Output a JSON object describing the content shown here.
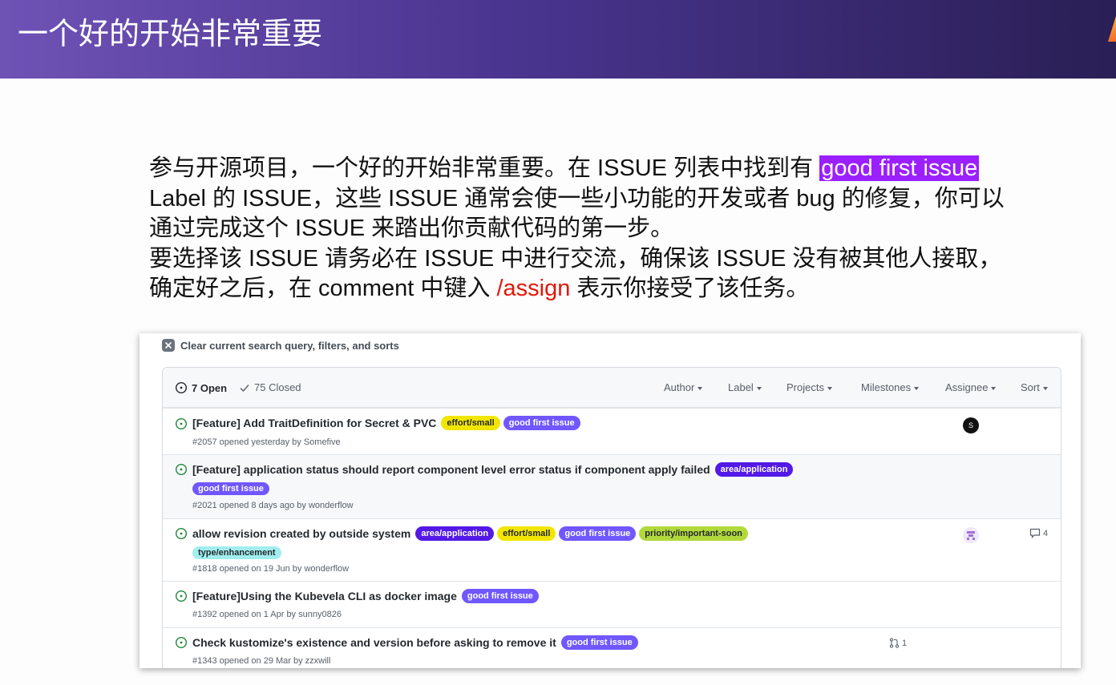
{
  "slide": {
    "title": "一个好的开始非常重要",
    "intro": {
      "l1_a": "参与开源项目，一个好的开始非常重要。在 ISSUE 列表中找到有 ",
      "l1_hl": "good first issue",
      "l2": "Label 的 ISSUE，这些 ISSUE 通常会使一些小功能的开发或者 bug 的修复，你可以",
      "l3": "通过完成这个 ISSUE 来踏出你贡献代码的第一步。",
      "l4": "要选择该 ISSUE 请务必在 ISSUE 中进行交流，确保该 ISSUE 没有被其他人接取，",
      "l5_a": "确定好之后，在 comment 中键入 ",
      "l5_red": "/assign",
      "l5_b": " 表示你接受了该任务。"
    }
  },
  "issues": {
    "clear_text": "Clear current search query, filters, and sorts",
    "open_count": "7 Open",
    "closed_count": "75 Closed",
    "filters": {
      "author": "Author",
      "label": "Label",
      "projects": "Projects",
      "milestones": "Milestones",
      "assignee": "Assignee",
      "sort": "Sort"
    },
    "labels": {
      "effort_small": "effort/small",
      "good_first_issue": "good first issue",
      "area_application": "area/application",
      "priority_important_soon": "priority/important-soon",
      "type_enhancement": "type/enhancement"
    },
    "colors": {
      "effort_small": "#f2e600",
      "good_first_issue": "#7057ff",
      "area_application": "#5319e7",
      "priority_important_soon": "#b2d93b",
      "type_enhancement": "#a2eeef",
      "open_icon": "#22863a"
    },
    "rows": [
      {
        "title": "[Feature] Add TraitDefinition for Secret & PVC",
        "meta": "#2057 opened yesterday by Somefive",
        "assignee_avatar": "S"
      },
      {
        "title": "[Feature] application status should report component level error status if component apply failed",
        "meta": "#2021 opened 8 days ago by wonderflow"
      },
      {
        "title": "allow revision created by outside system",
        "meta": "#1818 opened on 19 Jun by wonderflow",
        "comments": "4"
      },
      {
        "title": "[Feature]Using the Kubevela CLI as docker image",
        "meta": "#1392 opened on 1 Apr by sunny0826"
      },
      {
        "title": "Check kustomize's existence and version before asking to remove it",
        "meta": "#1343 opened on 29 Mar by zzxwill",
        "linked_prs": "1"
      }
    ]
  }
}
